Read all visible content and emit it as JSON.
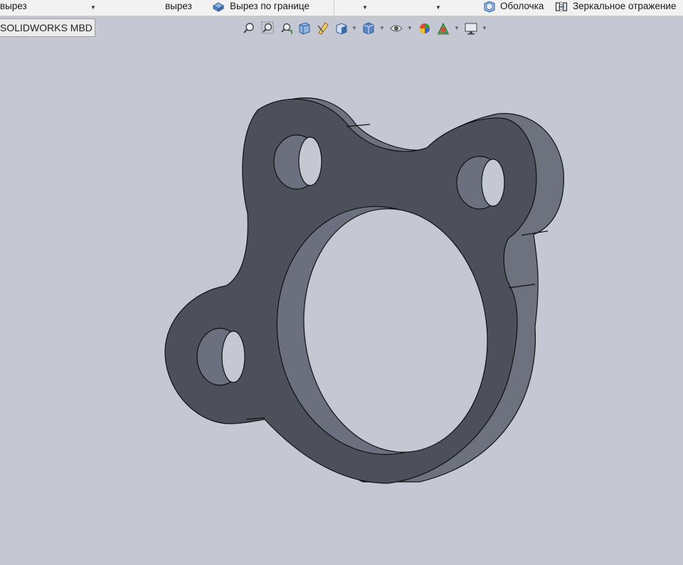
{
  "ribbon": {
    "cut_left": "вырез",
    "cut_mid": "вырез",
    "boundary_cut": "Вырез по границе",
    "shell": "Оболочка",
    "mirror": "Зеркальное отражение",
    "icons": [
      "boundary-cut-icon",
      "shell-icon",
      "mirror-icon"
    ]
  },
  "tabs": {
    "active": "SOLIDWORKS MBD"
  },
  "hud": {
    "icons": [
      "zoom-to-fit-icon",
      "zoom-to-area-icon",
      "previous-view-icon",
      "section-view-icon",
      "dynamic-annotation-icon",
      "view-orientation-icon",
      "display-style-icon",
      "hide-show-icon",
      "edit-appearance-icon",
      "apply-scene-icon",
      "view-settings-icon"
    ]
  },
  "model": {
    "name": "flange-part",
    "face_color": "#4d505b",
    "side_color": "#6b6e7b",
    "background": "#c5c8d2"
  }
}
